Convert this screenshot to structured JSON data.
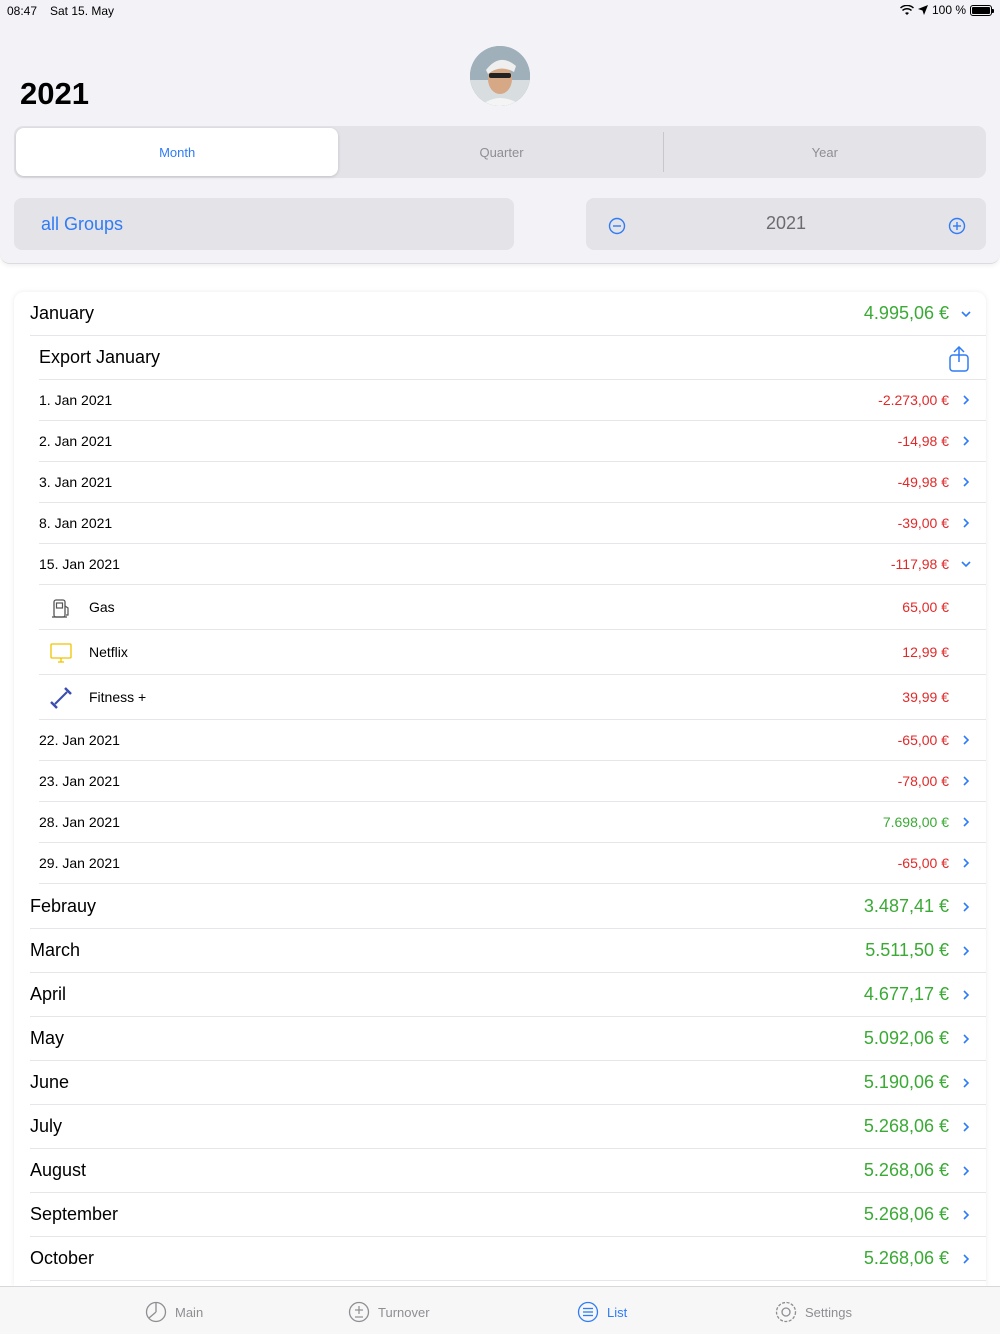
{
  "status": {
    "time": "08:47",
    "date": "Sat 15. May",
    "battery": "100 %"
  },
  "header": {
    "title": "2021"
  },
  "segments": [
    "Month",
    "Quarter",
    "Year"
  ],
  "filter": {
    "group": "all Groups",
    "year": "2021"
  },
  "january": {
    "label": "January",
    "amount": "4.995,06 €"
  },
  "export": {
    "label": "Export January"
  },
  "days": [
    {
      "label": "1. Jan 2021",
      "amount": "-2.273,00 €"
    },
    {
      "label": "2. Jan 2021",
      "amount": "-14,98 €"
    },
    {
      "label": "3. Jan 2021",
      "amount": "-49,98 €"
    },
    {
      "label": "8. Jan 2021",
      "amount": "-39,00 €"
    },
    {
      "label": "15. Jan 2021",
      "amount": "-117,98 €"
    },
    {
      "label": "22. Jan 2021",
      "amount": "-65,00 €"
    },
    {
      "label": "23. Jan 2021",
      "amount": "-78,00 €"
    },
    {
      "label": "28. Jan 2021",
      "amount": "7.698,00 €"
    },
    {
      "label": "29. Jan 2021",
      "amount": "-65,00 €"
    }
  ],
  "items": [
    {
      "label": "Gas",
      "amount": "65,00 €",
      "icon": "gas-pump-icon"
    },
    {
      "label": "Netflix",
      "amount": "12,99 €",
      "icon": "monitor-icon"
    },
    {
      "label": "Fitness +",
      "amount": "39,99 €",
      "icon": "dumbbell-icon"
    }
  ],
  "months": [
    {
      "label": "Febrauy",
      "amount": "3.487,41 €"
    },
    {
      "label": "March",
      "amount": "5.511,50 €"
    },
    {
      "label": "April",
      "amount": "4.677,17 €"
    },
    {
      "label": "May",
      "amount": "5.092,06 €"
    },
    {
      "label": "June",
      "amount": "5.190,06 €"
    },
    {
      "label": "July",
      "amount": "5.268,06 €"
    },
    {
      "label": "August",
      "amount": "5.268,06 €"
    },
    {
      "label": "September",
      "amount": "5.268,06 €"
    },
    {
      "label": "October",
      "amount": "5.268,06 €"
    }
  ],
  "tabs": [
    "Main",
    "Turnover",
    "List",
    "Settings"
  ],
  "colors": {
    "accent": "#2f7cf6",
    "positive": "#3aaa35",
    "negative": "#e02a2a"
  }
}
